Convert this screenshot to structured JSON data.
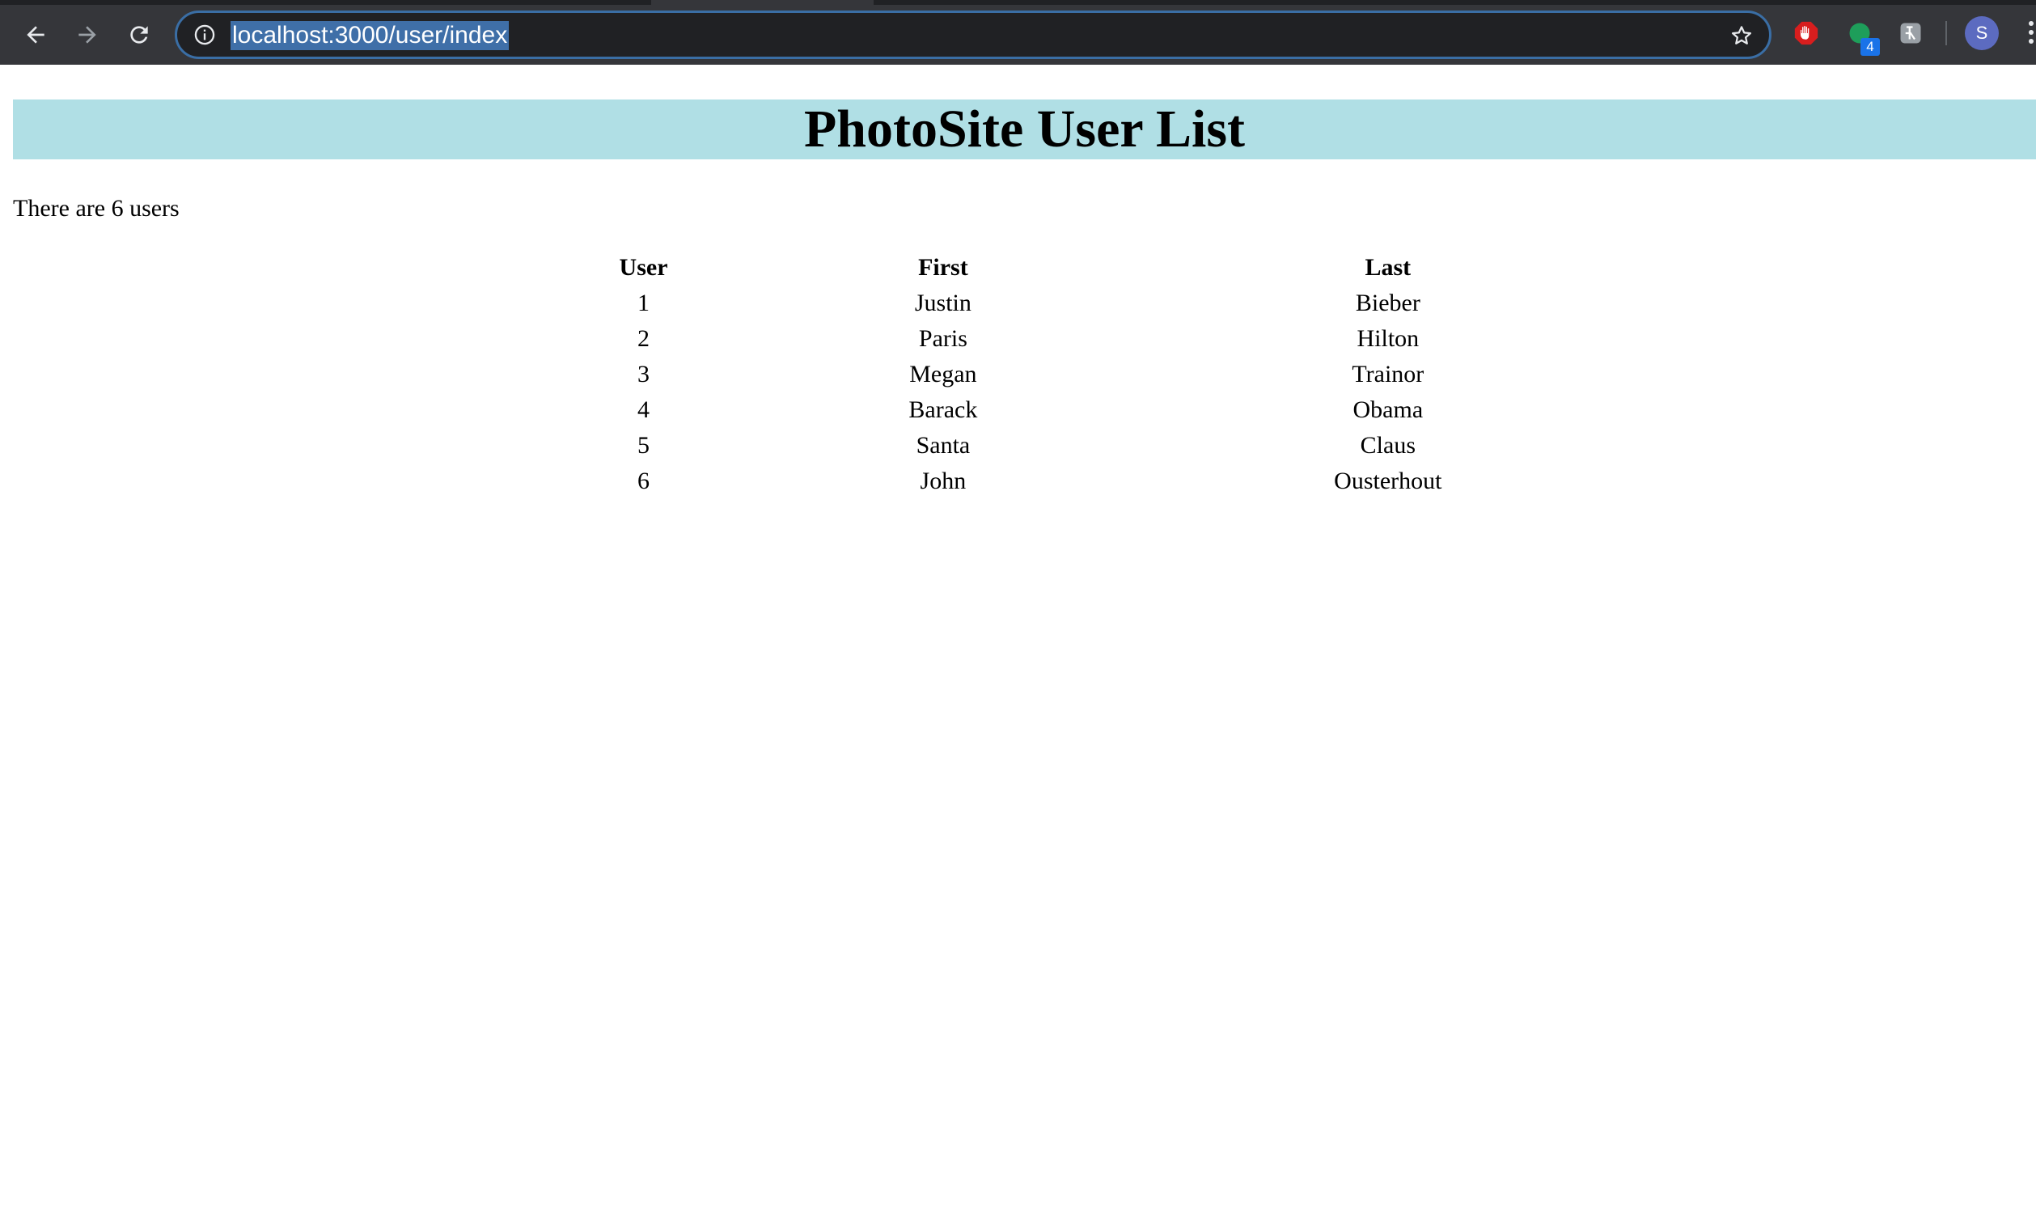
{
  "browser": {
    "url": "localhost:3000/user/index",
    "extension_badge": "4",
    "profile_initial": "S"
  },
  "page": {
    "title": "PhotoSite User List",
    "header_color": "#b0dfe5",
    "count_text": "There are 6 users",
    "table": {
      "headers": [
        "User",
        "First",
        "Last"
      ],
      "rows": [
        [
          "1",
          "Justin",
          "Bieber"
        ],
        [
          "2",
          "Paris",
          "Hilton"
        ],
        [
          "3",
          "Megan",
          "Trainor"
        ],
        [
          "4",
          "Barack",
          "Obama"
        ],
        [
          "5",
          "Santa",
          "Claus"
        ],
        [
          "6",
          "John",
          "Ousterhout"
        ]
      ]
    }
  }
}
